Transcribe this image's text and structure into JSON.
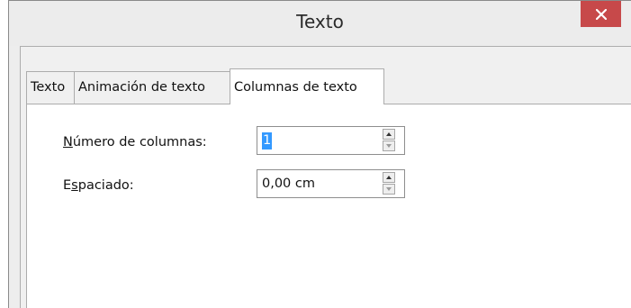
{
  "window": {
    "title": "Texto"
  },
  "tabs": [
    {
      "label": "Texto"
    },
    {
      "label": "Animación de texto"
    },
    {
      "label": "Columnas de texto",
      "selected": true
    }
  ],
  "fields": {
    "columns": {
      "label_accel": "N",
      "label_rest": "úmero de columnas:",
      "value": "1"
    },
    "spacing": {
      "label_first": "E",
      "label_accel": "s",
      "label_rest": "paciado:",
      "value": "0,00 cm"
    }
  },
  "icons": {
    "close": "close-icon",
    "spin_up": "arrow-up-icon",
    "spin_down": "arrow-down-icon"
  },
  "colors": {
    "close_button": "#c7494a",
    "selection": "#3399ff"
  }
}
